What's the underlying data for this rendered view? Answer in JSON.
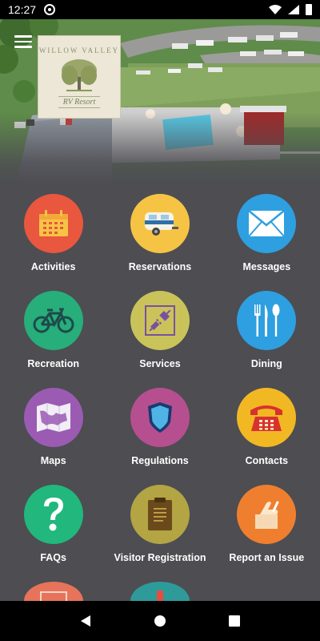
{
  "status_bar": {
    "time": "12:27"
  },
  "header": {
    "logo_line1": "WILLOW VALLEY",
    "logo_line2": "RV Resort"
  },
  "tiles": [
    {
      "label": "Activities",
      "color": "#e8573e",
      "icon": "calendar-icon"
    },
    {
      "label": "Reservations",
      "color": "#f6c445",
      "icon": "camper-trailer-icon"
    },
    {
      "label": "Messages",
      "color": "#2e9fe0",
      "icon": "envelope-icon"
    },
    {
      "label": "Recreation",
      "color": "#27ae7a",
      "icon": "bicycle-icon"
    },
    {
      "label": "Services",
      "color": "#c9c35a",
      "icon": "plug-icon"
    },
    {
      "label": "Dining",
      "color": "#2e9fe0",
      "icon": "fork-knife-spoon-icon"
    },
    {
      "label": "Maps",
      "color": "#9b5bb3",
      "icon": "map-icon"
    },
    {
      "label": "Regulations",
      "color": "#b54f8f",
      "icon": "shield-icon"
    },
    {
      "label": "Contacts",
      "color": "#f2b823",
      "icon": "telephone-icon"
    },
    {
      "label": "FAQs",
      "color": "#21b77d",
      "icon": "question-mark-icon"
    },
    {
      "label": "Visitor Registration",
      "color": "#b3a444",
      "icon": "clipboard-icon"
    },
    {
      "label": "Report an Issue",
      "color": "#ef7f2f",
      "icon": "report-hand-icon"
    },
    {
      "label": "",
      "color": "#e6735a",
      "icon": "partial-icon"
    },
    {
      "label": "",
      "color": "#2e9b9a",
      "icon": "partial-icon"
    }
  ],
  "colors": {
    "background": "#4d4d52",
    "status_bar": "#000000",
    "nav_bar": "#000000"
  }
}
